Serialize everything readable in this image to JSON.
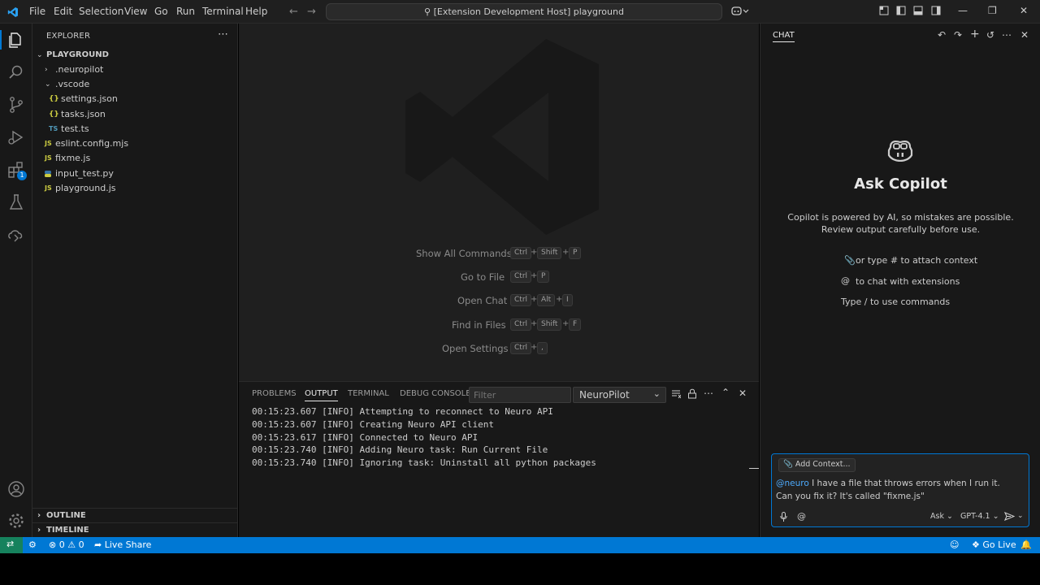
{
  "titlebar": {
    "menu": [
      "File",
      "Edit",
      "Selection",
      "View",
      "Go",
      "Run",
      "Terminal",
      "Help"
    ],
    "command_center": "[Extension Development Host] playground"
  },
  "activity": {
    "extensions_badge": "1"
  },
  "explorer": {
    "title": "EXPLORER",
    "root": "PLAYGROUND",
    "items": [
      {
        "label": ".neuropilot",
        "kind": "folder-collapsed"
      },
      {
        "label": ".vscode",
        "kind": "folder-open"
      },
      {
        "label": "settings.json",
        "kind": "json",
        "icon": "{}"
      },
      {
        "label": "tasks.json",
        "kind": "json",
        "icon": "{}"
      },
      {
        "label": "test.ts",
        "kind": "ts",
        "icon": "TS"
      },
      {
        "label": "eslint.config.mjs",
        "kind": "js",
        "icon": "JS"
      },
      {
        "label": "fixme.js",
        "kind": "js",
        "icon": "JS"
      },
      {
        "label": "input_test.py",
        "kind": "py",
        "icon": "py"
      },
      {
        "label": "playground.js",
        "kind": "js",
        "icon": "JS"
      }
    ],
    "outline": "OUTLINE",
    "timeline": "TIMELINE"
  },
  "watermark": [
    {
      "label": "Show All Commands",
      "keys": [
        "Ctrl",
        "Shift",
        "P"
      ]
    },
    {
      "label": "Go to File",
      "keys": [
        "Ctrl",
        "P"
      ]
    },
    {
      "label": "Open Chat",
      "keys": [
        "Ctrl",
        "Alt",
        "I"
      ]
    },
    {
      "label": "Find in Files",
      "keys": [
        "Ctrl",
        "Shift",
        "F"
      ]
    },
    {
      "label": "Open Settings",
      "keys": [
        "Ctrl",
        ","
      ]
    }
  ],
  "panel": {
    "tabs": [
      "PROBLEMS",
      "OUTPUT",
      "TERMINAL",
      "DEBUG CONSOLE"
    ],
    "active_tab": "OUTPUT",
    "filter_placeholder": "Filter",
    "channel": "NeuroPilot",
    "log": [
      "00:15:23.607 [INFO] Attempting to reconnect to Neuro API",
      "00:15:23.607 [INFO] Creating Neuro API client",
      "00:15:23.617 [INFO] Connected to Neuro API",
      "00:15:23.740 [INFO] Adding Neuro task: Run Current File",
      "00:15:23.740 [INFO] Ignoring task: Uninstall all python packages"
    ]
  },
  "chat": {
    "tab": "CHAT",
    "title": "Ask Copilot",
    "description": "Copilot is powered by AI, so mistakes are possible. Review output carefully before use.",
    "hints": {
      "attach": "or type # to attach context",
      "extensions": "to chat with extensions",
      "commands": "Type / to use commands"
    },
    "add_context": "Add Context...",
    "mention": "@neuro",
    "message": " I have a file that throws errors when I run it. Can you fix it? It's called \"fixme.js\"",
    "mode": "Ask",
    "model": "GPT-4.1"
  },
  "statusbar": {
    "errors": "0",
    "warnings": "0",
    "live_share": "Live Share",
    "go_live": "Go Live"
  },
  "colors": {
    "accent": "#0078d4",
    "remote": "#16825d",
    "js_icon": "#cbcb41",
    "ts_icon": "#519aba",
    "json_icon": "#cbcb41",
    "py_icon": "#3572a5"
  }
}
